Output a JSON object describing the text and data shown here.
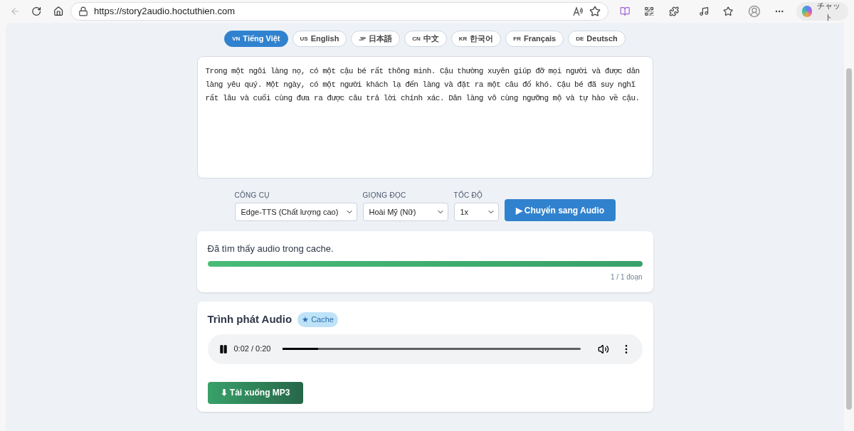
{
  "browser": {
    "url": "https://story2audio.hoctuthien.com",
    "chat_label": "チャット"
  },
  "languages": [
    {
      "code": "VN",
      "label": "Tiếng Việt",
      "selected": true
    },
    {
      "code": "US",
      "label": "English",
      "selected": false
    },
    {
      "code": "JP",
      "label": "日本語",
      "selected": false
    },
    {
      "code": "CN",
      "label": "中文",
      "selected": false
    },
    {
      "code": "KR",
      "label": "한국어",
      "selected": false
    },
    {
      "code": "FR",
      "label": "Français",
      "selected": false
    },
    {
      "code": "DE",
      "label": "Deutsch",
      "selected": false
    }
  ],
  "story_text": "Trong một ngôi làng nọ, có một cậu bé rất thông minh. Cậu thường xuyên giúp đỡ mọi người và được dân làng yêu quý. Một ngày, có một người khách lạ đến làng và đặt ra một câu đố khó. Cậu bé đã suy nghĩ rất lâu và cuối cùng đưa ra được câu trả lời chính xác. Dân làng vô cùng ngưỡng mộ và tự hào về cậu.",
  "controls": [
    {
      "label": "CÔNG CỤ",
      "value": "Edge-TTS (Chất lượng cao)"
    },
    {
      "label": "GIỌNG ĐỌC",
      "value": "Hoài Mỹ (Nữ)"
    },
    {
      "label": "TỐC ĐỘ",
      "value": "1x"
    }
  ],
  "convert_button": "▶ Chuyển sang Audio",
  "status": {
    "message": "Đã tìm thấy audio trong cache.",
    "level": 1,
    "count": "1 / 1 đoạn"
  },
  "player": {
    "title": "Trình phát Audio",
    "badge": "★ Cache",
    "time": "0:02 / 0:20",
    "playing": true,
    "level": 0.12
  },
  "download_button": "⬇ Tải xuống MP3"
}
